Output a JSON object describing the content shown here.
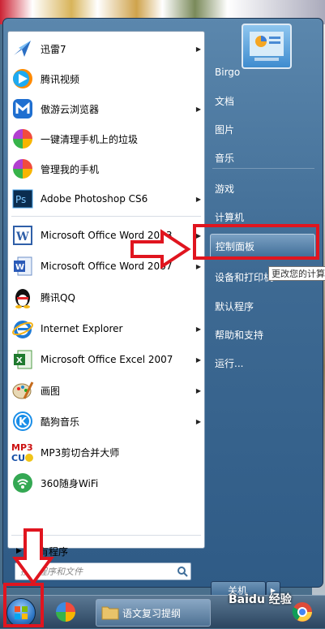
{
  "programs": [
    {
      "label": "迅雷7",
      "icon": "thunder-bird-icon",
      "submenu": true
    },
    {
      "label": "腾讯视频",
      "icon": "tencent-video-icon",
      "submenu": false
    },
    {
      "label": "傲游云浏览器",
      "icon": "maxthon-icon",
      "submenu": true
    },
    {
      "label": "一键清理手机上的垃圾",
      "icon": "pinwheel-icon",
      "submenu": false
    },
    {
      "label": "管理我的手机",
      "icon": "pinwheel-icon",
      "submenu": false
    },
    {
      "label": "Adobe Photoshop CS6",
      "icon": "photoshop-icon",
      "submenu": true
    },
    {
      "label": "Microsoft Office Word 2003",
      "icon": "word-icon",
      "submenu": true
    },
    {
      "label": "Microsoft Office Word 2007",
      "icon": "word-icon",
      "submenu": true
    },
    {
      "label": "腾讯QQ",
      "icon": "qq-penguin-icon",
      "submenu": false
    },
    {
      "label": "Internet Explorer",
      "icon": "ie-icon",
      "submenu": true
    },
    {
      "label": "Microsoft Office Excel 2007",
      "icon": "excel-icon",
      "submenu": true
    },
    {
      "label": "画图",
      "icon": "paint-icon",
      "submenu": true
    },
    {
      "label": "酷狗音乐",
      "icon": "kugou-icon",
      "submenu": true
    },
    {
      "label": "MP3剪切合并大师",
      "icon": "mp3-cutter-icon",
      "submenu": false
    },
    {
      "label": "360随身WiFi",
      "icon": "wifi-360-icon",
      "submenu": false
    }
  ],
  "all_programs": "所有程序",
  "search": {
    "placeholder": "搜索程序和文件"
  },
  "right_menu": [
    {
      "label": "Birgo"
    },
    {
      "label": "文档"
    },
    {
      "label": "图片"
    },
    {
      "label": "音乐"
    },
    {
      "label": "游戏"
    },
    {
      "label": "计算机"
    },
    {
      "label": "控制面板"
    },
    {
      "label": "设备和打印机"
    },
    {
      "label": "默认程序"
    },
    {
      "label": "帮助和支持"
    },
    {
      "label": "运行..."
    }
  ],
  "tooltip": "更改您的计算",
  "shutdown": {
    "label": "关机"
  },
  "taskbar": {
    "task_label": "语文复习提纲",
    "watermark": "Baidu 经验"
  },
  "colors": {
    "annotation": "#e0151f",
    "menu_blue": "#3e6a93"
  }
}
